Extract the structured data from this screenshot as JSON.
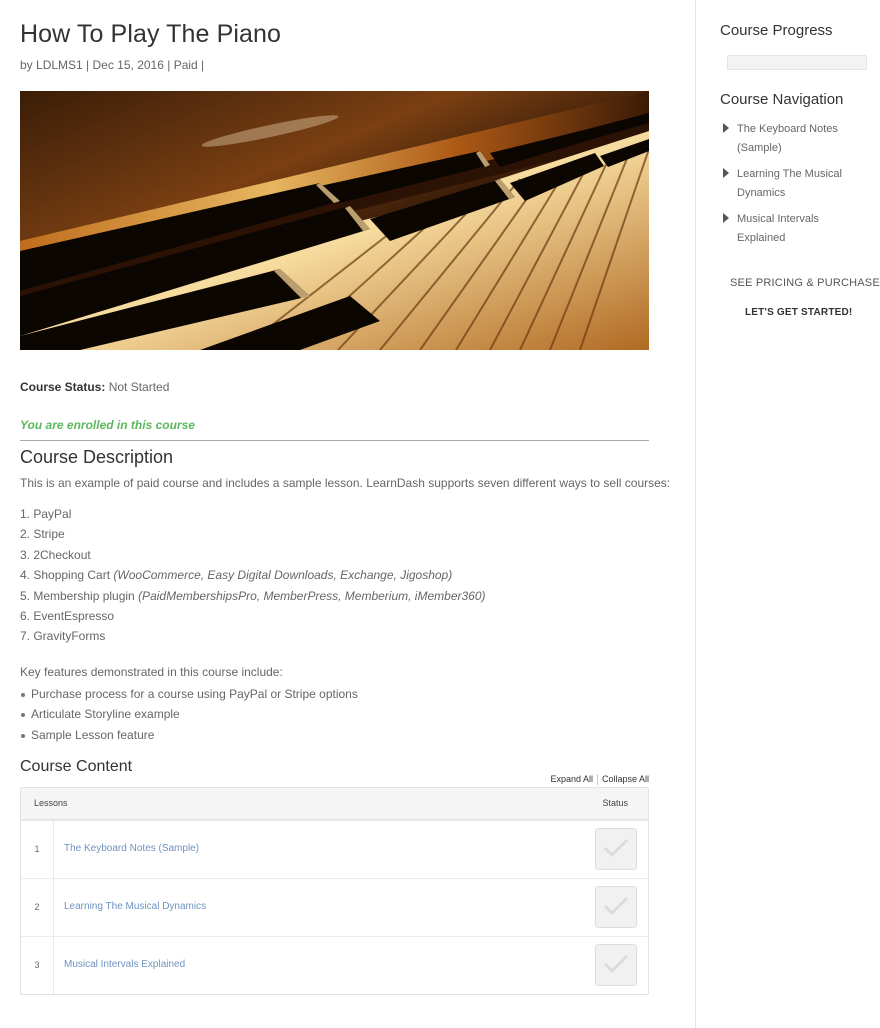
{
  "post": {
    "title": "How To Play The Piano",
    "meta": {
      "by": "by ",
      "author": "LDLMS1",
      "sep1": " | ",
      "date": "Dec 15, 2016",
      "sep2": " | ",
      "category": "Paid",
      "sep3": " |"
    }
  },
  "hero": {
    "alt": "piano-keys-photo"
  },
  "course_status": {
    "label": "Course Status:",
    "value": " Not Started"
  },
  "enrolled_text": "You are enrolled in this course",
  "description": {
    "heading": "Course Description",
    "intro": "This is an example of paid course and includes a sample lesson.  LearnDash supports seven different ways to sell courses:",
    "ways": [
      {
        "text": "1. PayPal",
        "note": ""
      },
      {
        "text": "2. Stripe",
        "note": ""
      },
      {
        "text": "3. 2Checkout",
        "note": ""
      },
      {
        "text": "4. Shopping Cart ",
        "note": "(WooCommerce, Easy Digital Downloads, Exchange, Jigoshop)"
      },
      {
        "text": "5. Membership plugin ",
        "note": "(PaidMembershipsPro, MemberPress, Memberium, iMember360)"
      },
      {
        "text": "6. EventEspresso",
        "note": ""
      },
      {
        "text": "7. GravityForms",
        "note": ""
      }
    ],
    "features_heading": "Key features demonstrated in this course include:",
    "features": [
      "Purchase process for a course using PayPal or Stripe options",
      "Articulate Storyline example",
      "Sample Lesson feature"
    ]
  },
  "content": {
    "heading": "Course Content",
    "expand_all": "Expand All",
    "collapse_all": "Collapse All",
    "col_lessons": "Lessons",
    "col_status": "Status",
    "lessons": [
      {
        "num": "1",
        "title": "The Keyboard Notes (Sample)",
        "completed": false
      },
      {
        "num": "2",
        "title": "Learning The Musical Dynamics",
        "completed": false
      },
      {
        "num": "3",
        "title": "Musical Intervals Explained",
        "completed": false
      }
    ]
  },
  "sidebar": {
    "progress_heading": "Course Progress",
    "progress_percent": 0,
    "nav_heading": "Course Navigation",
    "nav_items": [
      {
        "line1": "The Keyboard Notes",
        "line2": "(Sample)"
      },
      {
        "line1": "Learning The Musical",
        "line2": "Dynamics"
      },
      {
        "line1": "Musical Intervals",
        "line2": "Explained"
      }
    ],
    "pricing_link": "SEE PRICING & PURCHASE",
    "started_link": "LET'S GET STARTED!"
  },
  "colors": {
    "enrolled": "#5cb85c",
    "lesson_link": "#6f93bf",
    "heading": "#333333",
    "body_text": "#666666"
  }
}
